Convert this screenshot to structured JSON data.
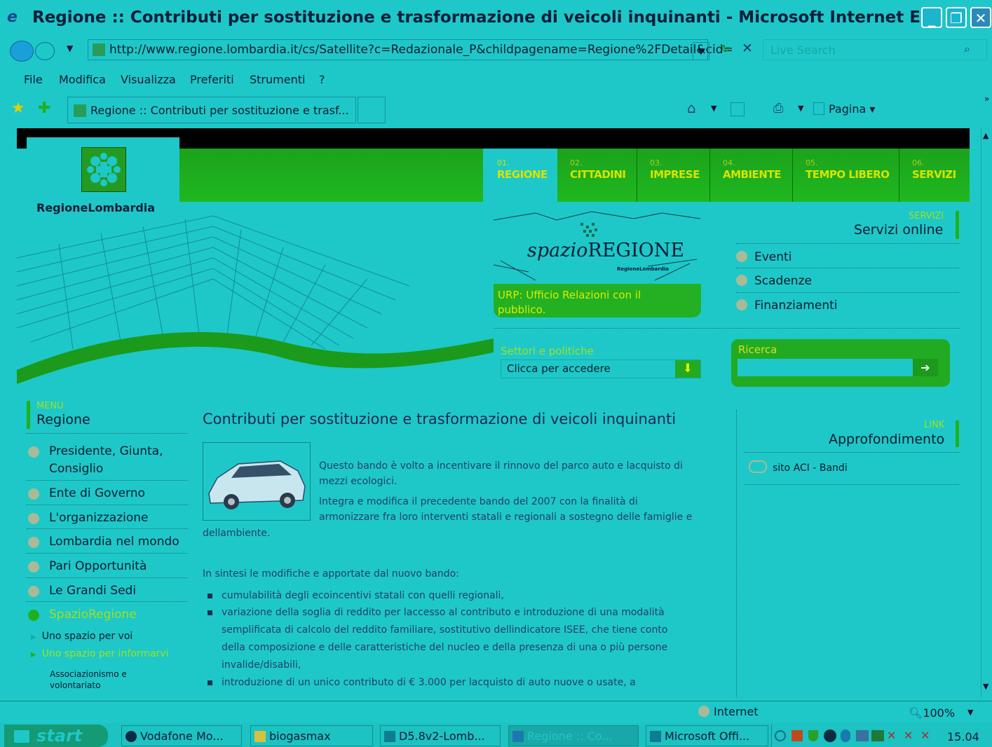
{
  "window": {
    "title": "Regione :: Contributi per sostituzione e trasformazione di veicoli inquinanti - Microsoft Internet E..."
  },
  "address": {
    "url": "http://www.regione.lombardia.it/cs/Satellite?c=Redazionale_P&childpagename=Regione%2FDetail&cid=",
    "search_placeholder": "Live Search"
  },
  "menubar": [
    "File",
    "Modifica",
    "Visualizza",
    "Preferiti",
    "Strumenti",
    "?"
  ],
  "tab": {
    "label": "Regione :: Contributi per sostituzione e trasf..."
  },
  "toolbar": {
    "page_label": "Pagina"
  },
  "site": {
    "logo_text": "RegioneLombardia",
    "nav": [
      {
        "num": "01.",
        "label": "REGIONE"
      },
      {
        "num": "02.",
        "label": "CITTADINI"
      },
      {
        "num": "03.",
        "label": "IMPRESE"
      },
      {
        "num": "04.",
        "label": "AMBIENTE"
      },
      {
        "num": "05.",
        "label": "TEMPO LIBERO"
      },
      {
        "num": "06.",
        "label": "SERVIZI"
      }
    ],
    "spazio": {
      "brand_italic": "spazio",
      "brand_caps": "REGIONE",
      "sub": "RegioneLombardia",
      "urp": "URP: Ufficio Relazioni con il pubblico."
    },
    "settori": {
      "label": "Settori e politiche",
      "value": "Clicca per accedere"
    },
    "ricerca": {
      "label": "Ricerca"
    },
    "servizi": {
      "caps": "SERVIZI",
      "title": "Servizi online",
      "items": [
        "Eventi",
        "Scadenze",
        "Finanziamenti"
      ]
    },
    "left_menu": {
      "caps": "MENU",
      "title": "Regione",
      "items": [
        "Presidente, Giunta,",
        "Consiglio",
        "Ente di Governo",
        "L'organizzazione",
        "Lombardia nel mondo",
        "Pari Opportunità",
        "Le Grandi Sedi",
        "SpazioRegione"
      ],
      "sub_items": [
        "Uno spazio per voi",
        "Uno spazio per informarvi"
      ],
      "sub_sub": [
        "Associazionismo e",
        "volontariato"
      ]
    },
    "article": {
      "title": "Contributi per sostituzione e trasformazione di veicoli inquinanti",
      "p1a": "Questo bando è volto a incentivare il rinnovo del parco auto e lacquisto di",
      "p1b": "mezzi ecologici.",
      "p2a": "Integra e modifica il precedente bando del 2007 con la finalità di",
      "p2b": "armonizzare fra loro interventi statali e regionali a sostegno delle famiglie e",
      "p2c": "dellambiente.",
      "intro": "In sintesi le modifiche e apportate dal nuovo bando:",
      "b1": "cumulabilità degli ecoincentivi statali con quelli regionali,",
      "b2a": "variazione della soglia di reddito per laccesso al contributo e introduzione di una modalità",
      "b2b": "semplificata di calcolo del reddito familiare, sostitutivo dellindicatore ISEE, che tiene conto",
      "b2c": "della composizione e delle caratteristiche del nucleo e della presenza di una o più persone",
      "b2d": "invalide/disabili,",
      "b3": "introduzione di un unico contributo di € 3.000 per lacquisto di auto nuove o usate, a"
    },
    "link": {
      "caps": "LINK",
      "title": "Approfondimento",
      "item": "sito ACI - Bandi"
    }
  },
  "status": {
    "zone": "Internet",
    "zoom": "100%"
  },
  "taskbar": {
    "start": "start",
    "items": [
      "Vodafone Mo...",
      "biogasmax",
      "D5.8v2-Lomb...",
      "Regione :: Co...",
      "Microsoft Offi..."
    ],
    "clock": "15.04"
  }
}
